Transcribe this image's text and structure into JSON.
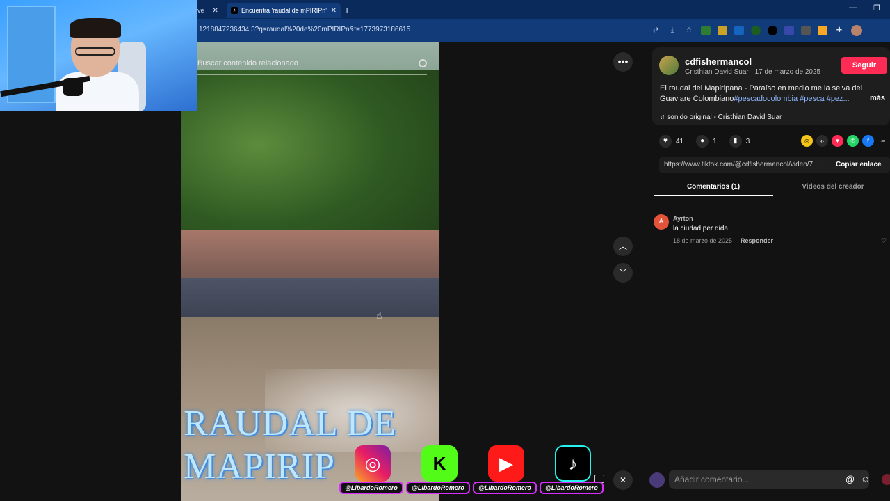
{
  "browser": {
    "partial_tab_label": "ve",
    "active_tab_title": "Encuentra 'raudal de mPIRIPn'",
    "tab_icon": "tiktok-icon",
    "url": "1218847236434 3?q=raudal%20de%20mPIRIPn&t=1773973186615",
    "new_tab": "+",
    "minimize": "—",
    "restore": "❐"
  },
  "video": {
    "search_placeholder": "Buscar contenido relacionado",
    "overlay_title": "RAUDAL DE MAPIRIP"
  },
  "socials": [
    {
      "name": "instagram",
      "glyph": "◎",
      "handle": "@LibardoRomero"
    },
    {
      "name": "kick",
      "glyph": "K",
      "handle": "@LibardoRomero"
    },
    {
      "name": "youtube",
      "glyph": "▶",
      "handle": "@LibardoRomero"
    },
    {
      "name": "tiktok",
      "glyph": "♪",
      "handle": "@LibardoRomero"
    }
  ],
  "creator": {
    "username": "cdfishermancol",
    "meta": "Cristhian David Suar · 17 de marzo de 2025",
    "follow_label": "Seguir",
    "description_text": "El raudal del Mapiripana - Paraíso en medio me la selva del Guaviare Colombiano",
    "description_tags": "#pescadocolombia #pesca #pez...",
    "more_label": "más",
    "sound": "sonido original - Cristhian David Suar"
  },
  "stats": {
    "likes": "41",
    "comments": "1",
    "saves": "3"
  },
  "share": {
    "link": "https://www.tiktok.com/@cdfishermancol/video/7...",
    "copy_label": "Copiar enlace"
  },
  "tabs": {
    "comments": "Comentarios (1)",
    "videos": "Videos del creador"
  },
  "comments": [
    {
      "initial": "A",
      "user": "Ayrton",
      "text": "la ciudad per dida",
      "date": "18 de marzo de 2025",
      "reply_label": "Responder"
    }
  ],
  "comment_input": {
    "placeholder": "Añadir comentario..."
  },
  "colors": {
    "accent": "#fe2c55",
    "tab_bar": "#0a2a5c",
    "address_bar": "#123b7a"
  }
}
